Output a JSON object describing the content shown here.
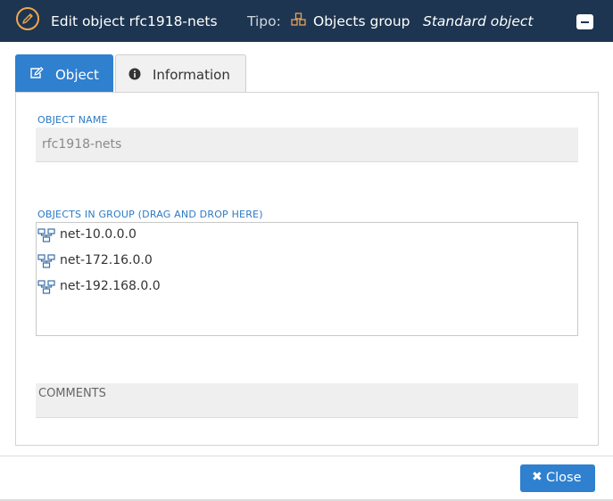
{
  "header": {
    "title": "Edit object rfc1918-nets",
    "tipo_label": "Tipo:",
    "type": "Objects group",
    "subtype": "Standard object"
  },
  "tabs": [
    {
      "label": "Object",
      "active": true
    },
    {
      "label": "Information",
      "active": false
    }
  ],
  "form": {
    "object_name_label": "OBJECT NAME",
    "object_name_value": "rfc1918-nets",
    "group_label": "OBJECTS IN GROUP (DRAG AND DROP HERE)",
    "group_items": [
      "net-10.0.0.0",
      "net-172.16.0.0",
      "net-192.168.0.0"
    ],
    "comments_label": "COMMENTS",
    "comments_value": ""
  },
  "footer": {
    "close_label": "Close"
  },
  "colors": {
    "header_bg": "#1d3550",
    "accent": "#2f80cf",
    "edit_icon": "#f0a64f",
    "group_icon": "#e8a35a"
  }
}
